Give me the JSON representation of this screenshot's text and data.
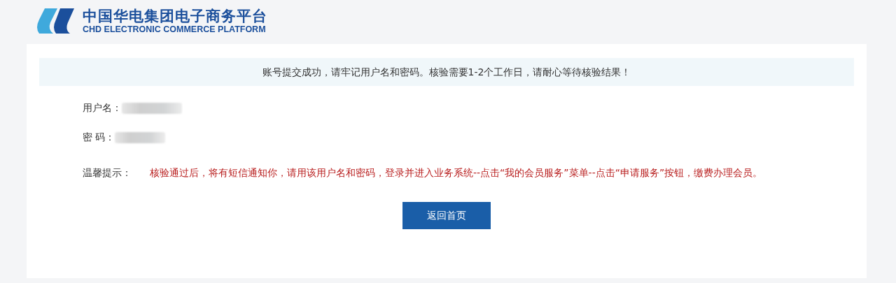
{
  "header": {
    "logo_title": "中国华电集团电子商务平台",
    "logo_subtitle": "CHD ELECTRONIC COMMERCE PLATFORM"
  },
  "notice": "账号提交成功，请牢记用户名和密码。核验需要1-2个工作日，请耐心等待核验结果！",
  "fields": [
    {
      "label": "用户名："
    },
    {
      "label": "密 码："
    }
  ],
  "tip": {
    "label": "温馨提示：",
    "text": "核验通过后，将有短信通知你，请用该用户名和密码，登录并进入业务系统--点击“我的会员服务”菜单--点击“申请服务”按钮，缴费办理会员。"
  },
  "button": "返回首页"
}
